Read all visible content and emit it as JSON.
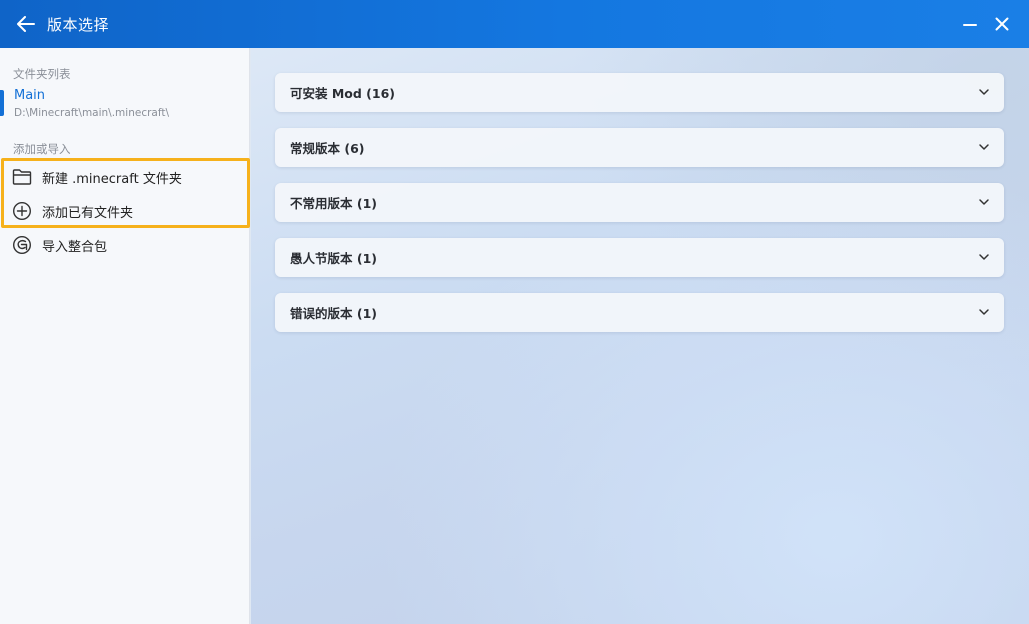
{
  "window": {
    "title": "版本选择",
    "accent": "#1370d6",
    "highlight": "#f6b11b"
  },
  "sidebar": {
    "folders_label": "文件夹列表",
    "folder": {
      "name": "Main",
      "path": "D:\\Minecraft\\main\\.minecraft\\"
    },
    "add_label": "添加或导入",
    "actions": [
      {
        "label": "新建 .minecraft 文件夹",
        "icon": "folder-icon"
      },
      {
        "label": "添加已有文件夹",
        "icon": "plus-circle-icon"
      },
      {
        "label": "导入整合包",
        "icon": "import-pack-icon"
      }
    ]
  },
  "main": {
    "groups": [
      {
        "label": "可安装 Mod (16)"
      },
      {
        "label": "常规版本 (6)"
      },
      {
        "label": "不常用版本 (1)"
      },
      {
        "label": "愚人节版本 (1)"
      },
      {
        "label": "错误的版本 (1)"
      }
    ]
  }
}
